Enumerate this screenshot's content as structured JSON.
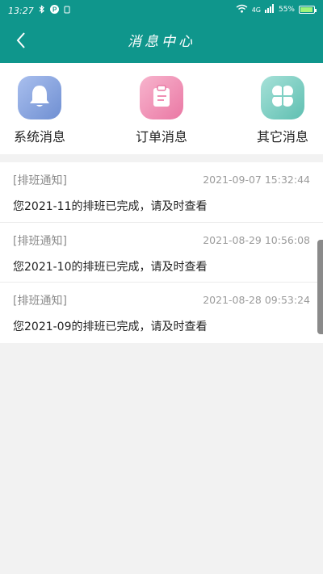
{
  "status_bar": {
    "time": "13:27",
    "network": "4G",
    "battery": "55%",
    "battery_level": 0.85,
    "left_icons": [
      "bluetooth-icon",
      "parking-p-icon",
      "app-notification-icon"
    ],
    "right_icons": [
      "wifi-icon",
      "signal-bars-icon",
      "battery-icon"
    ]
  },
  "header": {
    "title": "消息中心",
    "back_icon": "chevron-left-icon"
  },
  "categories": [
    {
      "label": "系统消息",
      "icon": "bell-icon",
      "color": "#7f9fd8"
    },
    {
      "label": "订单消息",
      "icon": "clipboard-icon",
      "color": "#f08fb4"
    },
    {
      "label": "其它消息",
      "icon": "clover-icon",
      "color": "#7fd0c4"
    }
  ],
  "messages": [
    {
      "type": "[排班通知]",
      "time": "2021-09-07 15:32:44",
      "content": "您2021-11的排班已完成，请及时查看"
    },
    {
      "type": "[排班通知]",
      "time": "2021-08-29 10:56:08",
      "content": "您2021-10的排班已完成，请及时查看"
    },
    {
      "type": "[排班通知]",
      "time": "2021-08-28 09:53:24",
      "content": "您2021-09的排班已完成，请及时查看"
    }
  ],
  "colors": {
    "brand": "#0f968c",
    "background": "#f2f2f2",
    "muted_text": "#8c8c8c"
  }
}
